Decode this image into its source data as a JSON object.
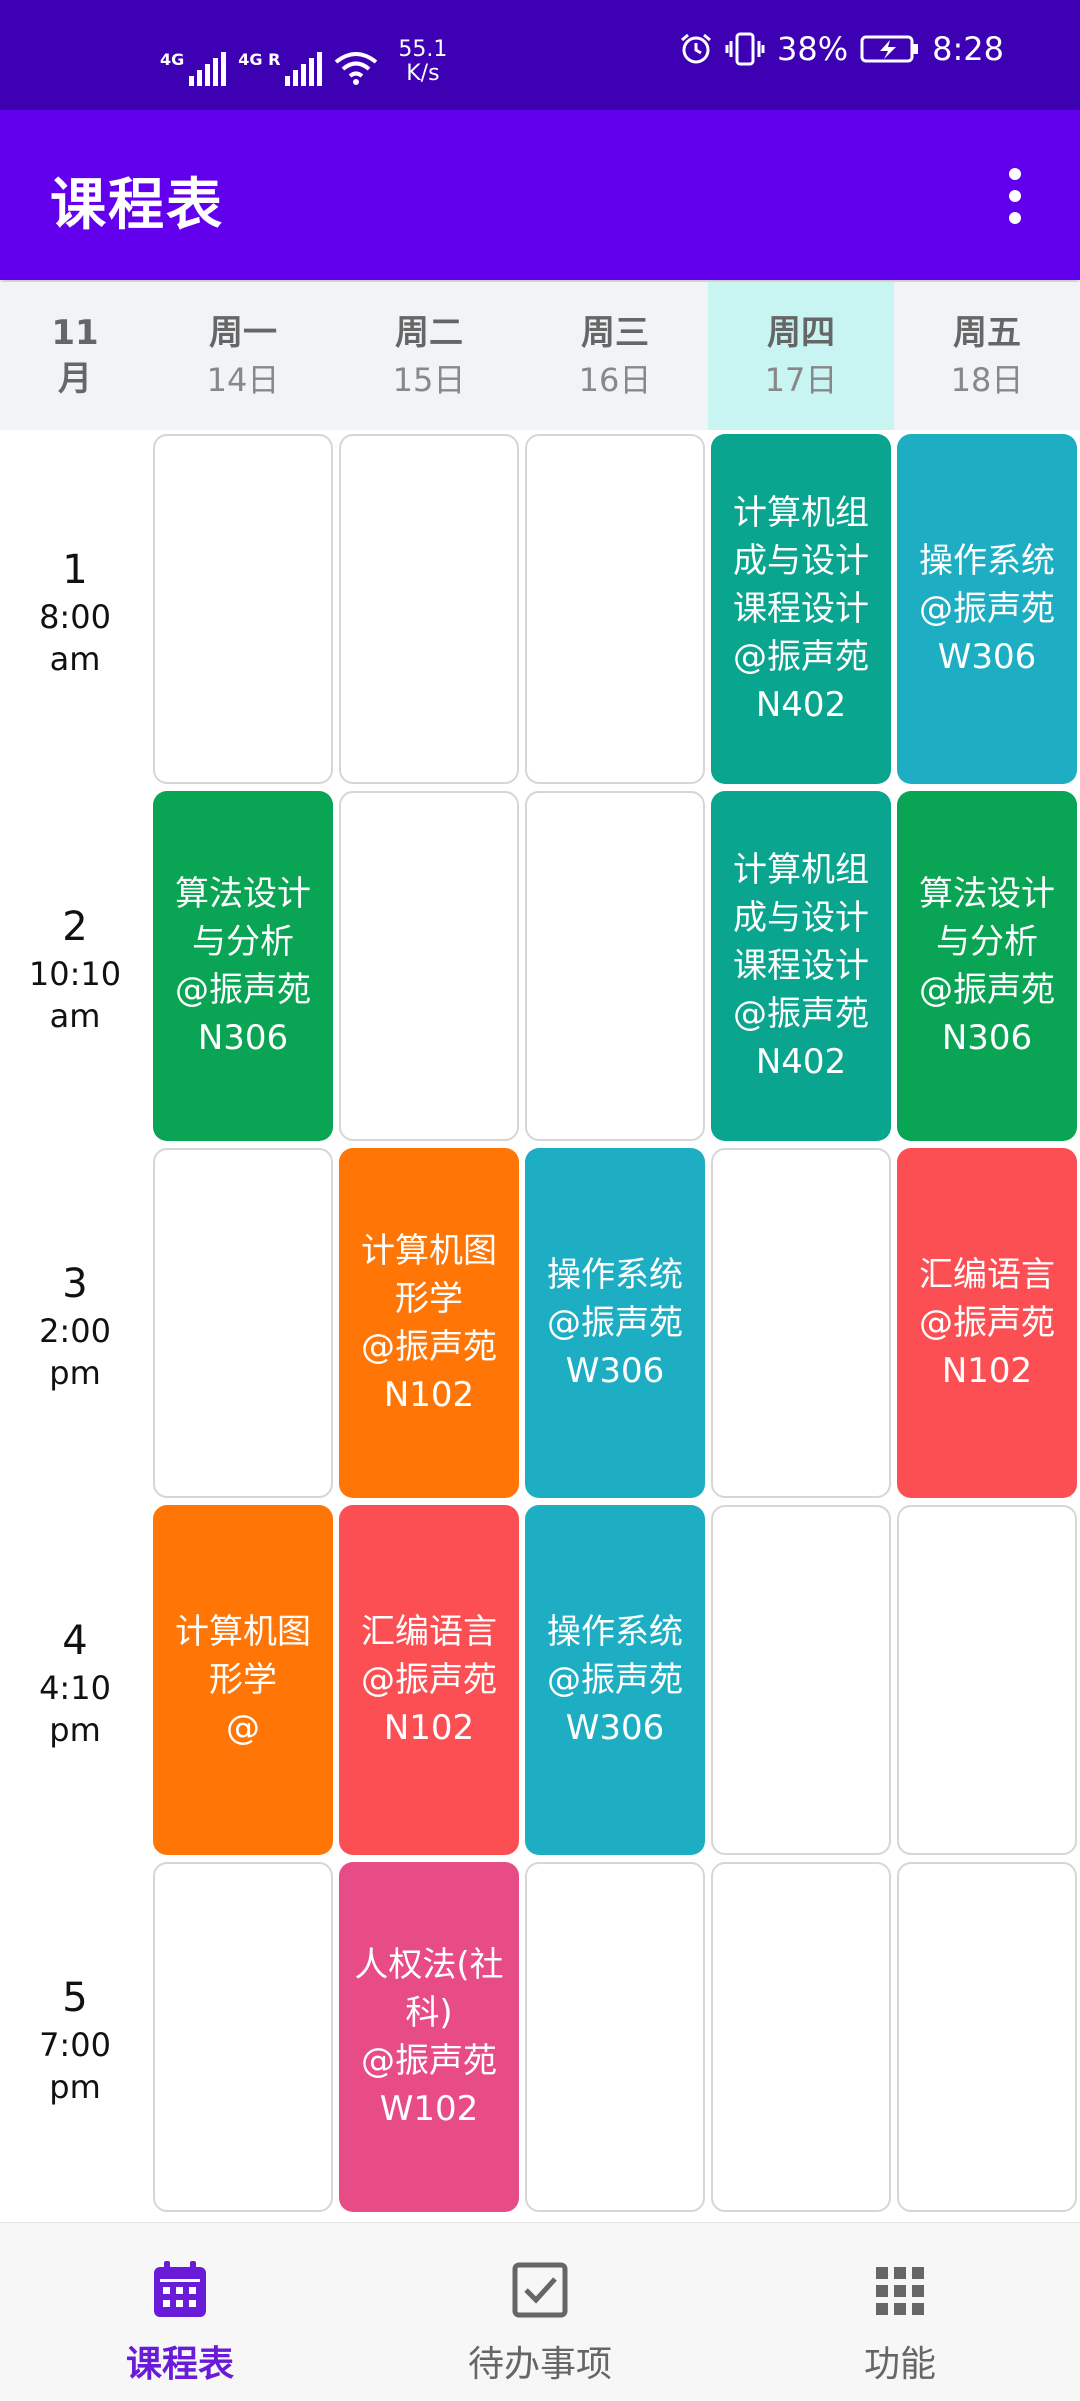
{
  "status_bar": {
    "network_1": "4G",
    "network_2": "4G R",
    "speed_value": "55.1",
    "speed_unit": "K/s",
    "battery": "38%",
    "time": "8:28",
    "icons": [
      "signal-icon",
      "signal-icon",
      "wifi-icon",
      "alarm-icon",
      "vibrate-icon",
      "battery-icon"
    ]
  },
  "app_bar": {
    "title": "课程表",
    "menu_icon": "more-vert-icon"
  },
  "header": {
    "month_number": "11",
    "month_unit": "月",
    "days": [
      {
        "name": "周一",
        "date": "14日"
      },
      {
        "name": "周二",
        "date": "15日"
      },
      {
        "name": "周三",
        "date": "16日"
      },
      {
        "name": "周四",
        "date": "17日",
        "today": true
      },
      {
        "name": "周五",
        "date": "18日"
      }
    ]
  },
  "slots": [
    {
      "num": "1",
      "time": "8:00",
      "ampm": "am"
    },
    {
      "num": "2",
      "time": "10:10",
      "ampm": "am"
    },
    {
      "num": "3",
      "time": "2:00",
      "ampm": "pm"
    },
    {
      "num": "4",
      "time": "4:10",
      "ampm": "pm"
    },
    {
      "num": "5",
      "time": "7:00",
      "ampm": "pm"
    }
  ],
  "schedule": [
    [
      null,
      null,
      null,
      {
        "text": "计算机组\n成与设计\n课程设计\n@振声苑\nN402",
        "color": "#0aa58f"
      },
      {
        "text": "操作系统\n@振声苑\nW306",
        "color": "#1eaec4"
      }
    ],
    [
      {
        "text": "算法设计\n与分析\n@振声苑\nN306",
        "color": "#0aa455"
      },
      null,
      null,
      {
        "text": "计算机组\n成与设计\n课程设计\n@振声苑\nN402",
        "color": "#0aa58f"
      },
      {
        "text": "算法设计\n与分析\n@振声苑\nN306",
        "color": "#0aa455"
      }
    ],
    [
      null,
      {
        "text": "计算机图\n形学\n@振声苑\nN102",
        "color": "#ff7506"
      },
      {
        "text": "操作系统\n@振声苑\nW306",
        "color": "#1eaec4"
      },
      null,
      {
        "text": "汇编语言\n@振声苑\nN102",
        "color": "#fb4f54"
      }
    ],
    [
      {
        "text": "计算机图\n形学\n@",
        "color": "#ff7506"
      },
      {
        "text": "汇编语言\n@振声苑\nN102",
        "color": "#fb4f54"
      },
      {
        "text": "操作系统\n@振声苑\nW306",
        "color": "#1eaec4"
      },
      null,
      null
    ],
    [
      null,
      {
        "text": "人权法(社\n科)\n@振声苑\nW102",
        "color": "#e84c87"
      },
      null,
      null,
      null
    ]
  ],
  "bottom_nav": [
    {
      "label": "课程表",
      "icon": "calendar-icon",
      "active": true,
      "color": "#6a1bd8"
    },
    {
      "label": "待办事项",
      "icon": "checkbox-icon",
      "active": false,
      "color": "#666666"
    },
    {
      "label": "功能",
      "icon": "grid-icon",
      "active": false,
      "color": "#666666"
    }
  ]
}
